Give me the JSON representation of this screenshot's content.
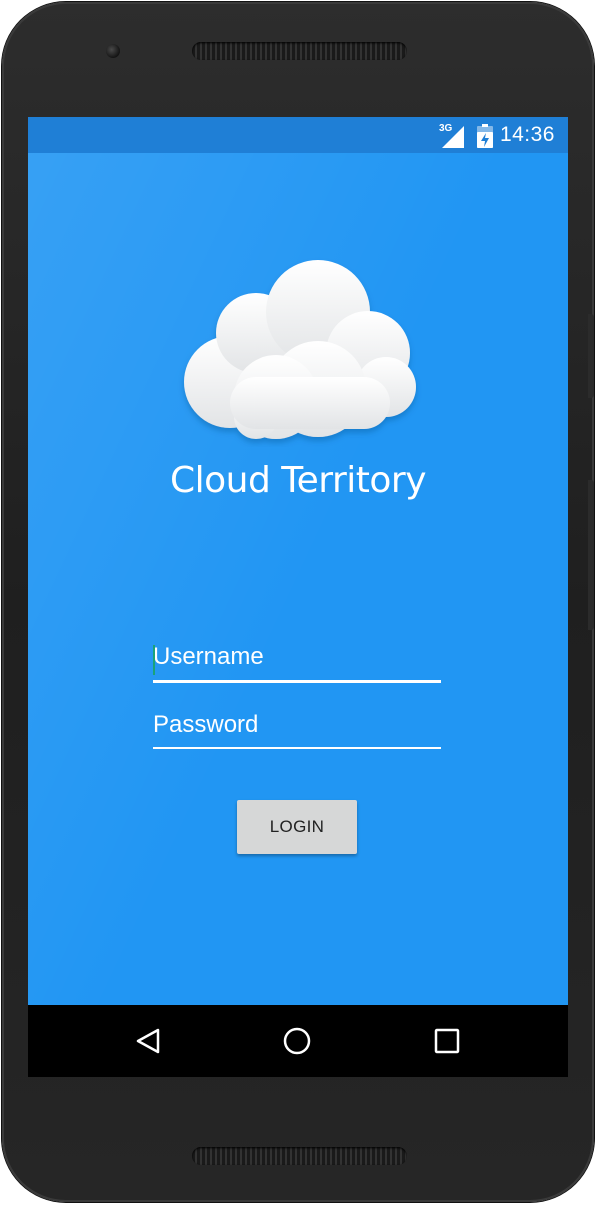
{
  "status_bar": {
    "network_type": "3G",
    "time": "14:36",
    "icons": [
      "signal-icon",
      "battery-icon"
    ]
  },
  "app": {
    "logo_icon": "cloud-icon",
    "title": "Cloud Territory"
  },
  "form": {
    "username": {
      "value": "",
      "placeholder": "Username"
    },
    "password": {
      "value": "",
      "placeholder": "Password"
    },
    "login_label": "LOGIN"
  },
  "nav_bar": {
    "icons": [
      "back-icon",
      "home-icon",
      "recents-icon"
    ]
  },
  "colors": {
    "screen_background": "#2196f3",
    "status_bar": "#1f7fd6",
    "button_background": "#d6d7d7",
    "cursor": "#1aa37a",
    "text": "#ffffff"
  }
}
